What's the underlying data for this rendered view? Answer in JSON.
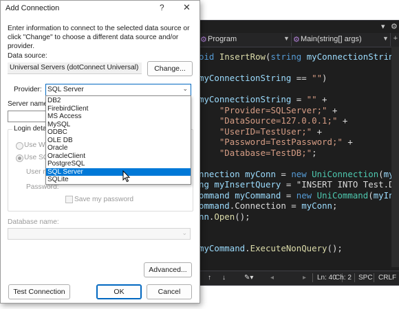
{
  "editor": {
    "nav_left": "Program",
    "nav_right": "Main(string[] args)",
    "code_lines": [
      "oid InsertRow(string myConnectionString)",
      "",
      "myConnectionString == \"\")",
      "",
      "myConnectionString = \"\" +",
      "    \"Provider=SQLServer;\" +",
      "    \"DataSource=127.0.0.1;\" +",
      "    \"UserID=TestUser;\" +",
      "    \"Password=TestPassword;\" +",
      "    \"Database=TestDB;\";",
      "",
      "nnection myConn = new UniConnection(myC",
      "ng myInsertQuery = \"INSERT INTO Test.Dep",
      "ommand myCommand = new UniCommand(myInse",
      "ommand.Connection = myConn;",
      "nn.Open();",
      "",
      "",
      "myCommand.ExecuteNonQuery();"
    ],
    "status": {
      "line": "Ln: 40",
      "col": "Ch: 2",
      "whitespace": "SPC",
      "line_endings": "CRLF"
    }
  },
  "dialog": {
    "title": "Add Connection",
    "help": "?",
    "close": "✕",
    "description": "Enter information to connect to the selected data source or click \"Change\" to choose a different data source and/or provider.",
    "data_source_label": "Data source:",
    "data_source_value": "Universal Servers (dotConnect Universal)",
    "change_button": "Change...",
    "provider_label": "Provider:",
    "provider_value": "SQL Server",
    "server_name_label": "Server name:",
    "login_group_label": "Login detail",
    "use_windows_label": "Use Win",
    "use_sql_label": "Use SQL",
    "user_name_label": "User n",
    "password_label": "Password:",
    "save_password_label": "Save my password",
    "database_name_label": "Database name:",
    "advanced_button": "Advanced...",
    "test_connection_button": "Test Connection",
    "ok_button": "OK",
    "cancel_button": "Cancel",
    "provider_options": [
      "DB2",
      "FirebirdClient",
      "MS Access",
      "MySQL",
      "ODBC",
      "OLE DB",
      "Oracle",
      "OracleClient",
      "PostgreSQL",
      "SQL Server",
      "SQLite"
    ],
    "selected_option": "SQL Server"
  },
  "colors": {
    "accent": "#0078d7",
    "editor_bg": "#1e1e1e",
    "keyword": "#569cd6",
    "string": "#d69d85"
  }
}
